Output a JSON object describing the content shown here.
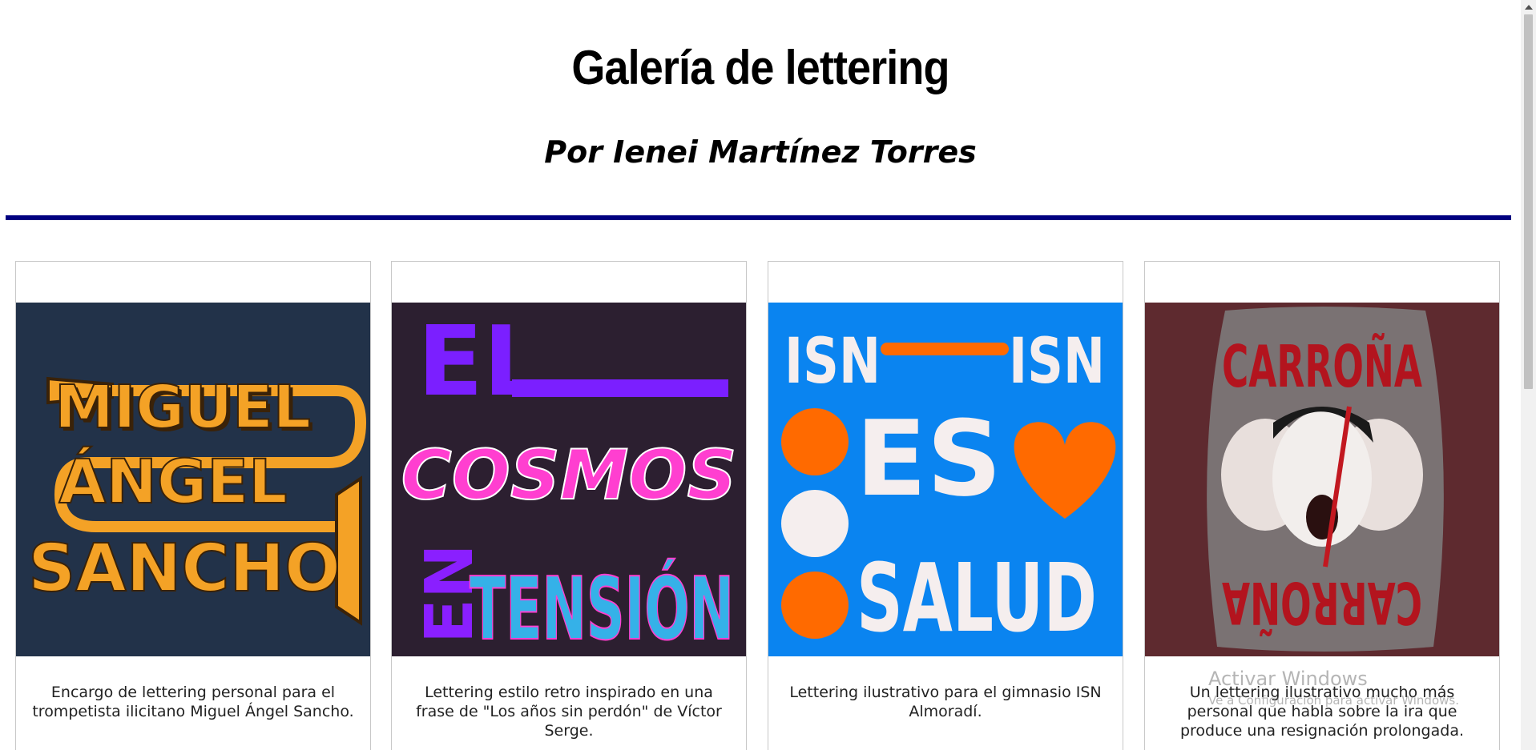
{
  "header": {
    "title": "Galería de lettering",
    "subtitle": "Por Ienei Martínez Torres"
  },
  "colors": {
    "rule": "#000080",
    "card_border": "#c8c8c8",
    "art1_bg": "#223249",
    "art2_bg": "#2c1f30",
    "art3_bg": "#0a84f0",
    "art4_bg": "#5e2a2f"
  },
  "gallery": [
    {
      "description": "Encargo de lettering personal para el trompetista ilicitano Miguel Ángel Sancho.",
      "art_words": [
        "MIGUEL",
        "ÁNGEL",
        "SANCHO"
      ]
    },
    {
      "description": "Lettering estilo retro inspirado en una frase de \"Los años sin perdón\" de Víctor Serge.",
      "art_words": [
        "EL",
        "COSMOS",
        "EN",
        "TENSIÓN"
      ]
    },
    {
      "description": "Lettering ilustrativo para el gimnasio ISN Almoradí.",
      "art_words": [
        "ISN",
        "ISN",
        "ES",
        "SALUD"
      ]
    },
    {
      "description": "Un lettering ilustrativo mucho más personal que habla sobre la ira que produce una resignación prolongada.",
      "art_words": [
        "CARROÑA",
        "CARROÑA"
      ]
    }
  ],
  "watermark": {
    "line1": "Activar Windows",
    "line2": "Ve a Configuración para activar Windows."
  }
}
